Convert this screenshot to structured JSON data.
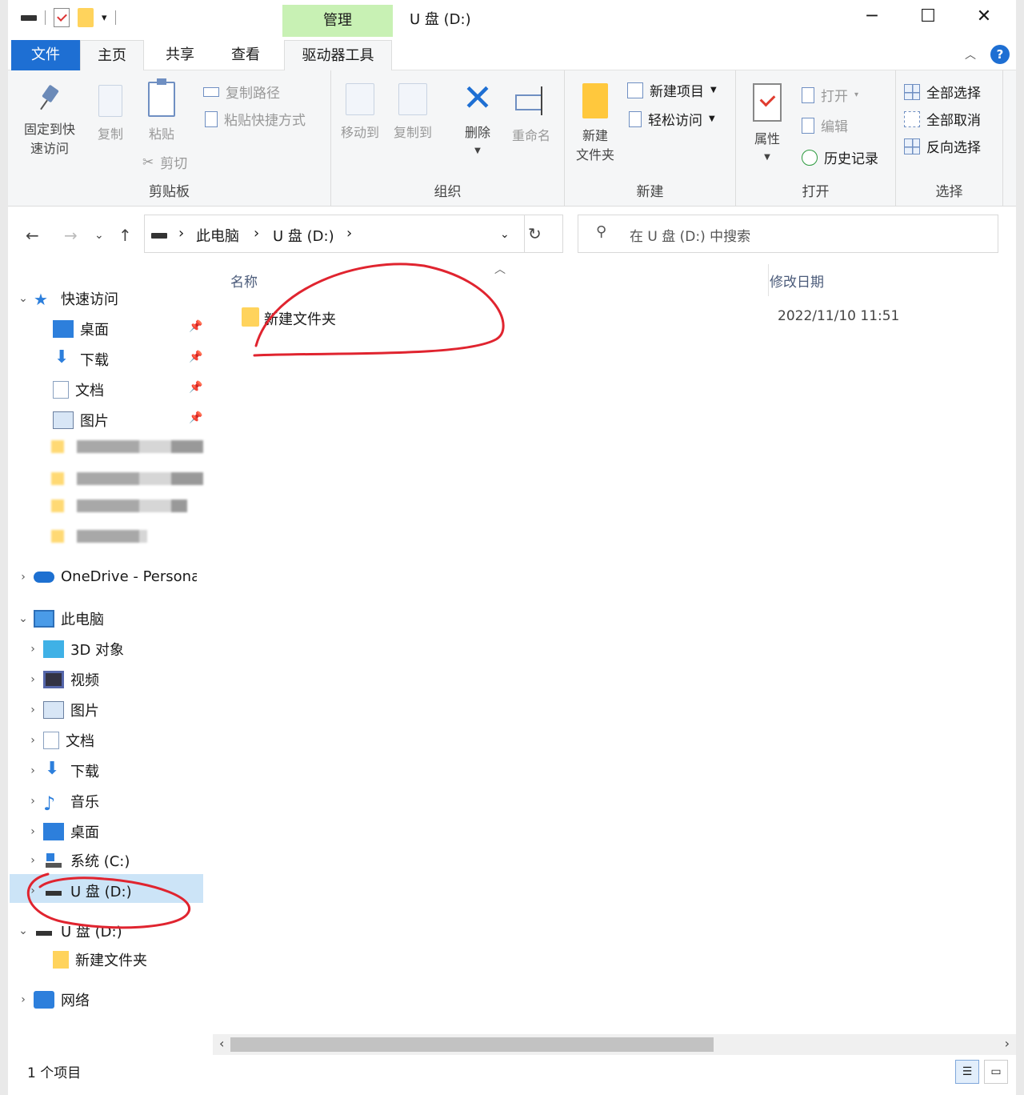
{
  "titlebar": {
    "title": "U 盘 (D:)",
    "manage_tab": "管理",
    "minimize": "─",
    "maximize": "☐",
    "close": "✕"
  },
  "tabs": {
    "file": "文件",
    "home": "主页",
    "share": "共享",
    "view": "查看",
    "drive_tools": "驱动器工具"
  },
  "ribbon": {
    "clipboard": {
      "label": "剪贴板",
      "pin_line1": "固定到快",
      "pin_line2": "速访问",
      "copy": "复制",
      "paste": "粘贴",
      "copy_path": "复制路径",
      "paste_shortcut": "粘贴快捷方式",
      "cut": "剪切"
    },
    "organize": {
      "label": "组织",
      "move_to": "移动到",
      "copy_to": "复制到",
      "delete": "删除",
      "rename": "重命名"
    },
    "new": {
      "label": "新建",
      "new_folder_line1": "新建",
      "new_folder_line2": "文件夹",
      "new_item": "新建项目",
      "easy_access": "轻松访问"
    },
    "open": {
      "label": "打开",
      "properties": "属性",
      "open": "打开",
      "edit": "编辑",
      "history": "历史记录"
    },
    "select": {
      "label": "选择",
      "select_all": "全部选择",
      "select_none": "全部取消",
      "invert": "反向选择"
    }
  },
  "address": {
    "crumbs": [
      "此电脑",
      "U 盘 (D:)"
    ],
    "search_placeholder": "在 U 盘 (D:) 中搜索"
  },
  "sidebar": {
    "quick_access": "快速访问",
    "qa_items": [
      "桌面",
      "下载",
      "文档",
      "图片"
    ],
    "onedrive": "OneDrive - Personal",
    "this_pc": "此电脑",
    "pc_items": [
      "3D 对象",
      "视频",
      "图片",
      "文档",
      "下载",
      "音乐",
      "桌面",
      "系统 (C:)",
      "U 盘 (D:)"
    ],
    "usb_root": "U 盘 (D:)",
    "usb_child": "新建文件夹",
    "network": "网络"
  },
  "content": {
    "col_name": "名称",
    "col_date": "修改日期",
    "files": [
      {
        "name": "新建文件夹",
        "date": "2022/11/10 11:51"
      }
    ]
  },
  "status": {
    "count": "1 个项目"
  },
  "colors": {
    "accent": "#1e6fd3",
    "manage_tab_bg": "#c8f1b4",
    "selection": "#cce4f7",
    "annotation": "#e0242f"
  }
}
